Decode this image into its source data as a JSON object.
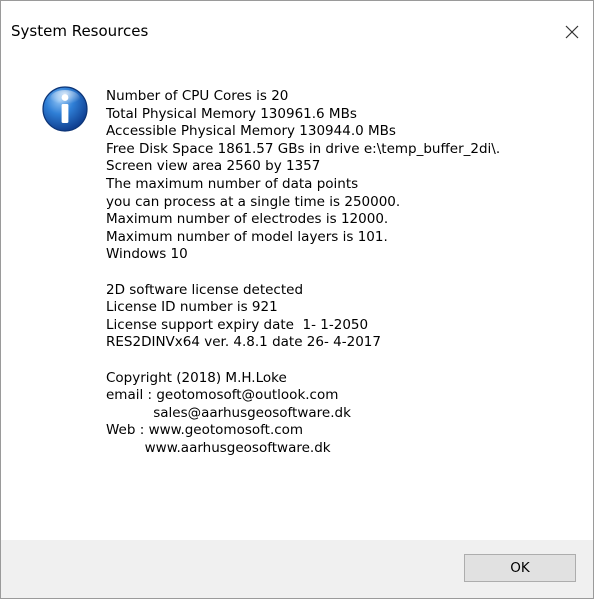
{
  "window": {
    "title": "System Resources",
    "close_icon": "close-x-icon"
  },
  "icon": {
    "name": "information-icon",
    "glyph": "i",
    "color": "#1f5fb5"
  },
  "message": {
    "system": [
      "Number of CPU Cores is 20",
      "Total Physical Memory 130961.6 MBs",
      "Accessible Physical Memory 130944.0 MBs",
      "Free Disk Space 1861.57 GBs in drive e:\\temp_buffer_2di\\.",
      "Screen view area 2560 by 1357",
      "The maximum number of data points",
      "you can process at a single time is 250000.",
      "Maximum number of electrodes is 12000.",
      "Maximum number of model layers is 101.",
      "Windows 10"
    ],
    "license": [
      "2D software license detected",
      "License ID number is 921",
      "License support expiry date  1- 1-2050",
      "RES2DINVx64 ver. 4.8.1 date 26- 4-2017"
    ],
    "copyright": [
      "Copyright (2018) M.H.Loke",
      "email : geotomosoft@outlook.com",
      "           sales@aarhusgeosoftware.dk",
      "Web : www.geotomosoft.com",
      "         www.aarhusgeosoftware.dk"
    ]
  },
  "buttons": {
    "ok_label": "OK"
  }
}
